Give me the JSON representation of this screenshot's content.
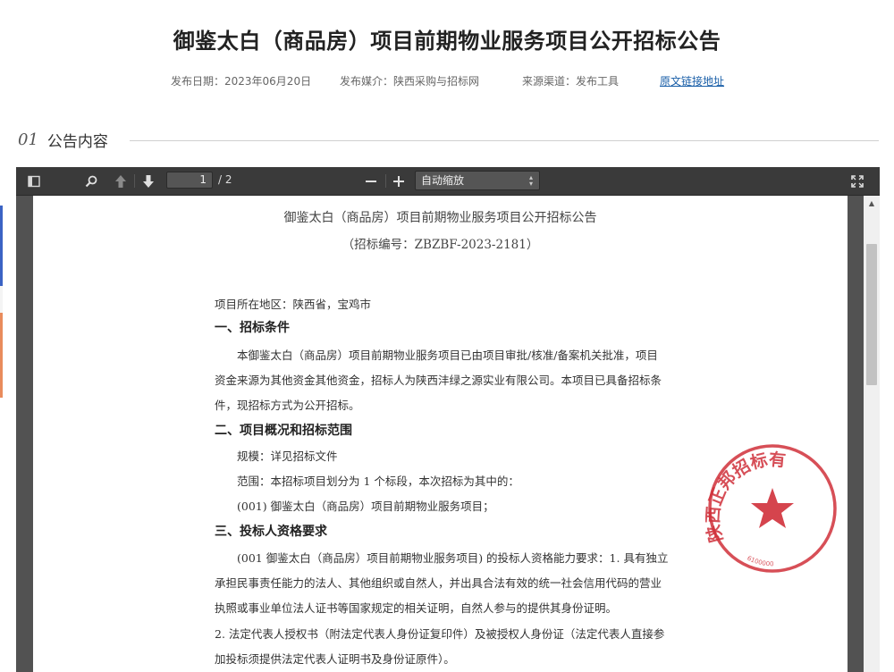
{
  "announcement": {
    "title": "御鉴太白（商品房）项目前期物业服务项目公开招标公告",
    "publish_date": "发布日期：2023年06月20日",
    "media": "发布媒介：陕西采购与招标网",
    "source": "来源渠道：发布工具",
    "original_link": "原文链接地址"
  },
  "section": {
    "number": "01",
    "label": "公告内容"
  },
  "viewer": {
    "page_current": "1",
    "page_total": "/ 2",
    "zoom": "自动缩放",
    "icons": {
      "sidebar": "sidebar-toggle-icon",
      "search": "search-icon",
      "prev": "arrow-up-icon",
      "next": "arrow-down-icon",
      "zoom_out": "minus-icon",
      "zoom_in": "plus-icon",
      "fullscreen": "fullscreen-icon"
    }
  },
  "document": {
    "title": "御鉴太白（商品房）项目前期物业服务项目公开招标公告",
    "code": "（招标编号：ZBZBF-2023-2181）",
    "location": "项目所在地区：陕西省，宝鸡市",
    "h1": "一、招标条件",
    "p1_l1": "本御鉴太白（商品房）项目前期物业服务项目已由项目审批/核准/备案机关批准，项目",
    "p1_l2": "资金来源为其他资金其他资金，招标人为陕西沣绿之源实业有限公司。本项目已具备招标条",
    "p1_l3": "件，现招标方式为公开招标。",
    "h2": "二、项目概况和招标范围",
    "p2_l1": "规模：详见招标文件",
    "p2_l2": "范围：本招标项目划分为 1 个标段，本次招标为其中的：",
    "p2_l3": "(001) 御鉴太白（商品房）项目前期物业服务项目；",
    "h3": "三、投标人资格要求",
    "p3_l1": "(001 御鉴太白（商品房）项目前期物业服务项目) 的投标人资格能力要求：1. 具有独立",
    "p3_l2": "承担民事责任能力的法人、其他组织或自然人，并出具合法有效的统一社会信用代码的营业",
    "p3_l3": "执照或事业单位法人证书等国家规定的相关证明，自然人参与的提供其身份证明。",
    "p3_l4": "2. 法定代表人授权书（附法定代表人身份证复印件）及被授权人身份证（法定代表人直接参",
    "p3_l5": "加投标须提供法定代表人证明书及身份证原件）。",
    "seal_text": "陕西正邦招标有",
    "seal_number": "6100000"
  },
  "colors": {
    "seal_red": "#d0303a",
    "link_blue": "#1a5fa8",
    "toolbar": "#3a3a3a"
  }
}
